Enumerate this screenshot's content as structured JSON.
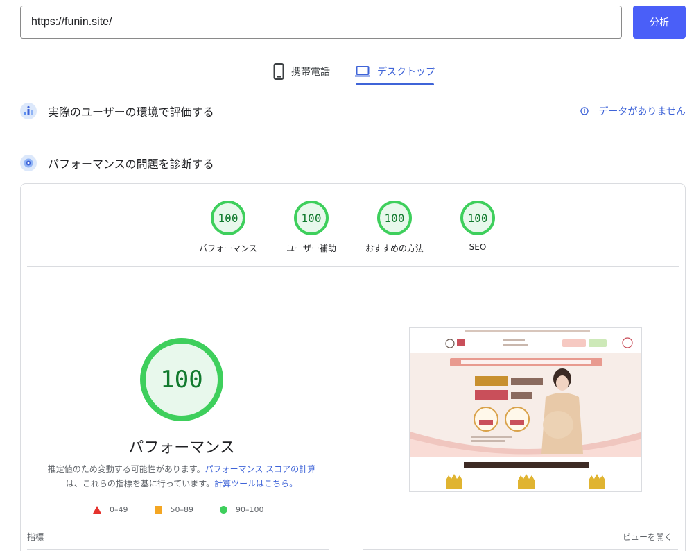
{
  "search": {
    "url_value": "https://funin.site/",
    "analyze_label": "分析"
  },
  "tabs": [
    {
      "label": "携帯電話",
      "icon": "phone-icon"
    },
    {
      "label": "デスクトップ",
      "icon": "laptop-icon",
      "active": true
    }
  ],
  "real_user": {
    "title": "実際のユーザーの環境で評価する",
    "no_data": "データがありません"
  },
  "diagnose": {
    "title": "パフォーマンスの問題を診断する"
  },
  "scores": [
    {
      "value": "100",
      "label": "パフォーマンス"
    },
    {
      "value": "100",
      "label": "ユーザー補助"
    },
    {
      "value": "100",
      "label": "おすすめの方法"
    },
    {
      "value": "100",
      "label": "SEO"
    }
  ],
  "performance": {
    "score": "100",
    "title": "パフォーマンス",
    "note_part1": "推定値のため変動する可能性があります。",
    "note_link1": "パフォーマンス スコアの計算",
    "note_part2": "は、これらの指標を基に行っています。",
    "note_link2": "計算ツールはこちら。"
  },
  "legend": [
    {
      "range": "0–49",
      "color": "#e5322d"
    },
    {
      "range": "50–89",
      "color": "#f4a623"
    },
    {
      "range": "90–100",
      "color": "#3ecf5c"
    }
  ],
  "thumbnail": {
    "logo_text": "ほうしん治療院",
    "banner": "妊しい命の誕生を願う全ての方のための不妊治療と鍼灸整体",
    "headline1": "妊娠しやすい",
    "headline2": "カラダづくり",
    "badge1_value": "83",
    "badge2_value": "0.5",
    "tagline": "当院で多くの方が妊娠されてます"
  },
  "footer": {
    "metrics_label": "指標",
    "open_view": "ビューを開く"
  },
  "colors": {
    "accent": "#3f64d8",
    "button": "#4a5ff8",
    "pass": "#3ecf5c"
  }
}
